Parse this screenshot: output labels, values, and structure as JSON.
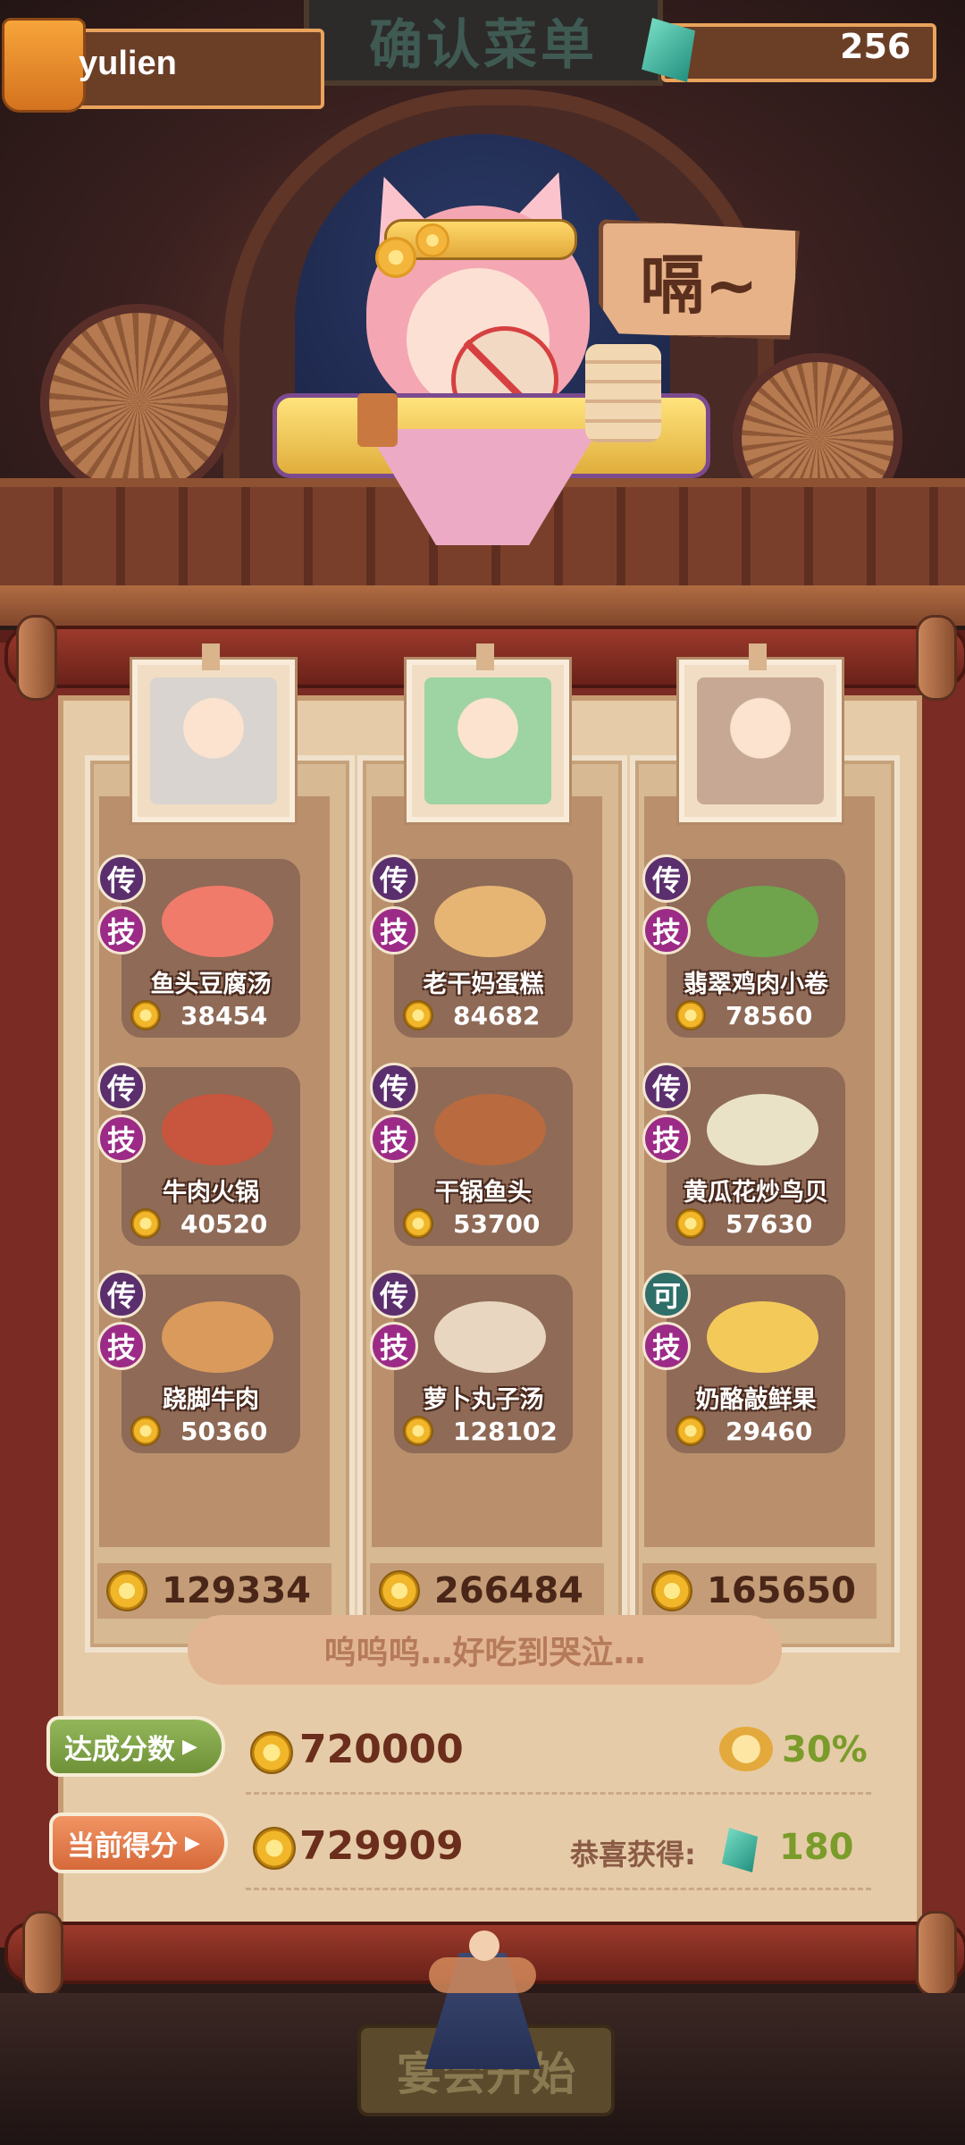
{
  "header": {
    "username": "yulien",
    "title": "确认菜单",
    "gems": "256"
  },
  "scene": {
    "speech_bubble": "嗝~"
  },
  "columns": [
    {
      "dishes": [
        {
          "badge_top": "传",
          "badge_bottom": "技",
          "name": "鱼头豆腐汤",
          "score": "38454",
          "food_color": "#f07b6a"
        },
        {
          "badge_top": "传",
          "badge_bottom": "技",
          "name": "牛肉火锅",
          "score": "40520",
          "food_color": "#c8553d"
        },
        {
          "badge_top": "传",
          "badge_bottom": "技",
          "name": "跷脚牛肉",
          "score": "50360",
          "food_color": "#d99a5b"
        }
      ],
      "total": "129334",
      "portrait_color": "#d9d4cf"
    },
    {
      "dishes": [
        {
          "badge_top": "传",
          "badge_bottom": "技",
          "name": "老干妈蛋糕",
          "score": "84682",
          "food_color": "#e6b574"
        },
        {
          "badge_top": "传",
          "badge_bottom": "技",
          "name": "干锅鱼头",
          "score": "53700",
          "food_color": "#b96a3f"
        },
        {
          "badge_top": "传",
          "badge_bottom": "技",
          "name": "萝卜丸子汤",
          "score": "128102",
          "food_color": "#e9d6c1"
        }
      ],
      "total": "266484",
      "portrait_color": "#9ed3a4"
    },
    {
      "dishes": [
        {
          "badge_top": "传",
          "badge_bottom": "技",
          "name": "翡翠鸡肉小卷",
          "score": "78560",
          "food_color": "#6fa34c"
        },
        {
          "badge_top": "传",
          "badge_bottom": "技",
          "name": "黄瓜花炒鸟贝",
          "score": "57630",
          "food_color": "#eae2c6"
        },
        {
          "badge_top": "可",
          "badge_bottom": "技",
          "name": "奶酪敲鲜果",
          "score": "29460",
          "food_color": "#f3c95a"
        }
      ],
      "total": "165650",
      "portrait_color": "#c7a894"
    }
  ],
  "comment": "呜呜呜…好吃到哭泣…",
  "summary": {
    "target_label": "达成分数",
    "target_score": "720000",
    "bonus_percent": "30%",
    "current_label": "当前得分",
    "current_score": "729909",
    "reward_label": "恭喜获得:",
    "reward_amount": "180"
  },
  "footer": {
    "start_button": "宴会开始"
  }
}
